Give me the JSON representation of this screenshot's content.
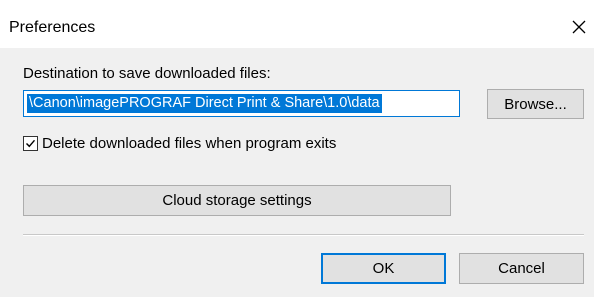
{
  "window": {
    "title": "Preferences",
    "close_icon": "close-icon"
  },
  "destination": {
    "label": "Destination to save downloaded files:",
    "path_value": "\\Canon\\imagePROGRAF Direct Print & Share\\1.0\\data",
    "browse_label": "Browse..."
  },
  "options": {
    "delete_on_exit_label": "Delete downloaded files when program exits",
    "delete_on_exit_checked": true
  },
  "cloud_button_label": "Cloud storage settings",
  "footer": {
    "ok_label": "OK",
    "cancel_label": "Cancel"
  },
  "colors": {
    "accent": "#0078d7",
    "dialog_bg": "#f0f0f0",
    "button_bg": "#e1e1e1"
  }
}
